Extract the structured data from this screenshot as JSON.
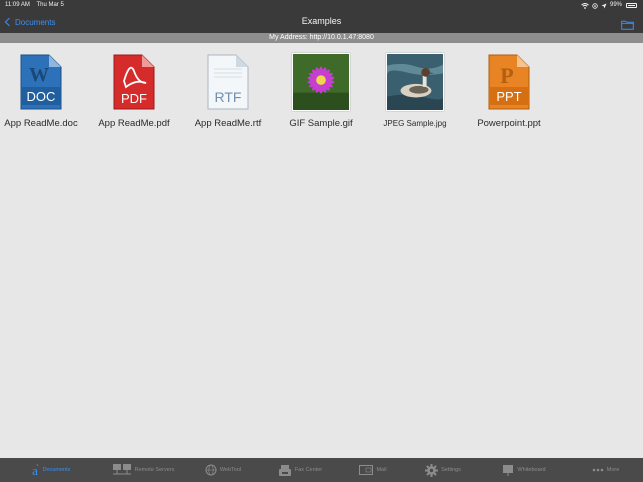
{
  "status_bar": {
    "time": "11:09 AM",
    "date": "Thu Mar 5",
    "battery": "99%"
  },
  "nav": {
    "back_label": "Documents",
    "title": "Examples"
  },
  "address_bar": {
    "text": "My Address: http://10.0.1.47:8080"
  },
  "files": [
    {
      "name": "App ReadMe.doc",
      "icon": "doc-file-icon",
      "badge": "DOC",
      "accent": "#2a6fb3"
    },
    {
      "name": "App ReadMe.pdf",
      "icon": "pdf-file-icon",
      "badge": "PDF",
      "accent": "#d42a2a"
    },
    {
      "name": "App ReadMe.rtf",
      "icon": "rtf-file-icon",
      "badge": "RTF",
      "accent": "#6e8fae"
    },
    {
      "name": "GIF Sample.gif",
      "icon": "flower-photo-thumbnail"
    },
    {
      "name": "JPEG Sample.jpg",
      "icon": "duck-photo-thumbnail"
    },
    {
      "name": "Powerpoint.ppt",
      "icon": "ppt-file-icon",
      "badge": "PPT",
      "accent": "#e8801c"
    }
  ],
  "tabs": [
    {
      "label": "Documents",
      "icon": "documents-icon",
      "active": true
    },
    {
      "label": "Remote Servers",
      "icon": "remote-servers-icon",
      "active": false
    },
    {
      "label": "WebTool",
      "icon": "globe-icon",
      "active": false
    },
    {
      "label": "Fax Center",
      "icon": "fax-icon",
      "active": false
    },
    {
      "label": "Mail",
      "icon": "mail-icon",
      "active": false
    },
    {
      "label": "Settings",
      "icon": "gear-icon",
      "active": false
    },
    {
      "label": "Whiteboard",
      "icon": "whiteboard-icon",
      "active": false
    },
    {
      "label": "More",
      "icon": "more-icon",
      "active": false
    }
  ],
  "colors": {
    "accent": "#3b8ff3",
    "bar_bg": "#3a3a3a",
    "address_bg": "#8e8e8e",
    "tabbar_bg": "#4a4a4a",
    "page_bg": "#e7e7e7"
  }
}
